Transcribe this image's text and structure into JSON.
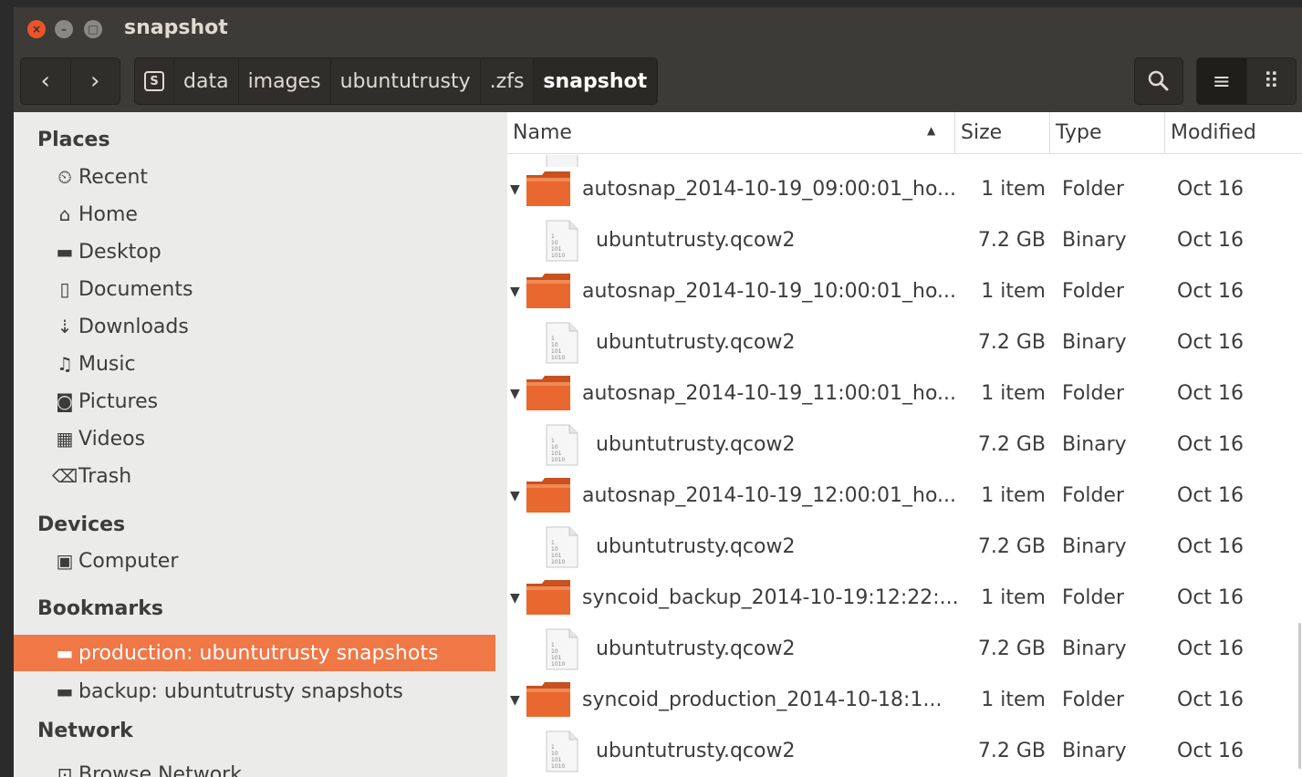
{
  "window": {
    "title": "snapshot",
    "close_glyph": "×",
    "min_glyph": "–",
    "max_glyph": "□"
  },
  "toolbar": {
    "back_glyph": "‹",
    "forward_glyph": "›",
    "breadcrumbs": [
      "data",
      "images",
      "ubuntutrusty",
      ".zfs",
      "snapshot"
    ],
    "home_glyph": "S",
    "list_view_glyph": "≡",
    "grid_view_glyph": "⠿"
  },
  "sidebar": {
    "sections": {
      "places": "Places",
      "devices": "Devices",
      "bookmarks": "Bookmarks",
      "network": "Network"
    },
    "places": [
      {
        "label": "Recent",
        "icon": "clock-icon",
        "glyph": "⏲"
      },
      {
        "label": "Home",
        "icon": "home-icon",
        "glyph": "⌂"
      },
      {
        "label": "Desktop",
        "icon": "folder-icon",
        "glyph": "▬"
      },
      {
        "label": "Documents",
        "icon": "document-icon",
        "glyph": "▯"
      },
      {
        "label": "Downloads",
        "icon": "download-icon",
        "glyph": "⇣"
      },
      {
        "label": "Music",
        "icon": "music-icon",
        "glyph": "♫"
      },
      {
        "label": "Pictures",
        "icon": "camera-icon",
        "glyph": "◙"
      },
      {
        "label": "Videos",
        "icon": "film-icon",
        "glyph": "▦"
      },
      {
        "label": "Trash",
        "icon": "trash-icon",
        "glyph": "⌫"
      }
    ],
    "devices": [
      {
        "label": "Computer",
        "icon": "computer-icon",
        "glyph": "▣"
      }
    ],
    "bookmarks": [
      {
        "label": "production: ubuntutrusty snapshots",
        "icon": "folder-icon",
        "glyph": "▬"
      },
      {
        "label": "backup: ubuntutrusty snapshots",
        "icon": "folder-icon",
        "glyph": "▬"
      }
    ],
    "network": [
      {
        "label": "Browse Network",
        "icon": "network-icon",
        "glyph": "⊡"
      }
    ]
  },
  "columns": {
    "name": "Name",
    "size": "Size",
    "type": "Type",
    "modified": "Modified",
    "sort_glyph": "▲"
  },
  "rows": [
    {
      "kind": "folder",
      "name": "autosnap_2014-10-19_09:00:01_ho...",
      "size": "1 item",
      "type": "Folder",
      "modified": "Oct 16"
    },
    {
      "kind": "file",
      "name": "ubuntutrusty.qcow2",
      "size": "7.2 GB",
      "type": "Binary",
      "modified": "Oct 16"
    },
    {
      "kind": "folder",
      "name": "autosnap_2014-10-19_10:00:01_ho...",
      "size": "1 item",
      "type": "Folder",
      "modified": "Oct 16"
    },
    {
      "kind": "file",
      "name": "ubuntutrusty.qcow2",
      "size": "7.2 GB",
      "type": "Binary",
      "modified": "Oct 16"
    },
    {
      "kind": "folder",
      "name": "autosnap_2014-10-19_11:00:01_ho...",
      "size": "1 item",
      "type": "Folder",
      "modified": "Oct 16"
    },
    {
      "kind": "file",
      "name": "ubuntutrusty.qcow2",
      "size": "7.2 GB",
      "type": "Binary",
      "modified": "Oct 16"
    },
    {
      "kind": "folder",
      "name": "autosnap_2014-10-19_12:00:01_ho...",
      "size": "1 item",
      "type": "Folder",
      "modified": "Oct 16"
    },
    {
      "kind": "file",
      "name": "ubuntutrusty.qcow2",
      "size": "7.2 GB",
      "type": "Binary",
      "modified": "Oct 16"
    },
    {
      "kind": "folder",
      "name": "syncoid_backup_2014-10-19:12:22:...",
      "size": "1 item",
      "type": "Folder",
      "modified": "Oct 16"
    },
    {
      "kind": "file",
      "name": "ubuntutrusty.qcow2",
      "size": "7.2 GB",
      "type": "Binary",
      "modified": "Oct 16"
    },
    {
      "kind": "folder",
      "name": "syncoid_production_2014-10-18:1...",
      "size": "1 item",
      "type": "Folder",
      "modified": "Oct 16"
    },
    {
      "kind": "file",
      "name": "ubuntutrusty.qcow2",
      "size": "7.2 GB",
      "type": "Binary",
      "modified": "Oct 16"
    }
  ],
  "colors": {
    "titlebar": "#3c3b37",
    "accent": "#f07746",
    "folder": "#e0612b",
    "sidebar": "#ebebea"
  }
}
